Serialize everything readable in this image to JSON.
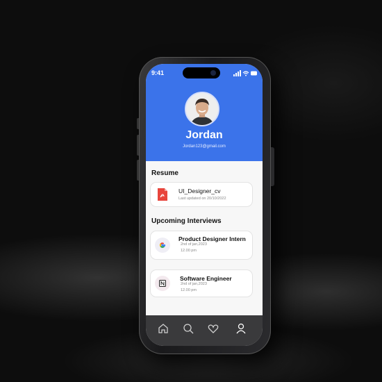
{
  "status_bar": {
    "time": "9:41"
  },
  "profile": {
    "name": "Jordan",
    "email": "Jordan123@gmail.com"
  },
  "resume": {
    "section_title": "Resume",
    "file_name": "UI_Designer_cv",
    "updated": "Last updated on 20/10/2022",
    "icon": "pdf-file-icon"
  },
  "interviews": {
    "section_title": "Upcoming Interviews",
    "items": [
      {
        "title": "Product Designer Intern",
        "date": "2nd of jan,2023",
        "time": "12.00 pm",
        "icon": "google-logo-icon"
      },
      {
        "title": "Software Engineer",
        "date": "2nd of jan,2023",
        "time": "12.00 pm",
        "icon": "notion-logo-icon"
      }
    ]
  },
  "nav": {
    "items": [
      "home-icon",
      "search-icon",
      "heart-icon",
      "profile-icon"
    ]
  },
  "colors": {
    "header": "#3b73ea",
    "nav": "#3a3a3c",
    "pdf": "#e8453c"
  }
}
